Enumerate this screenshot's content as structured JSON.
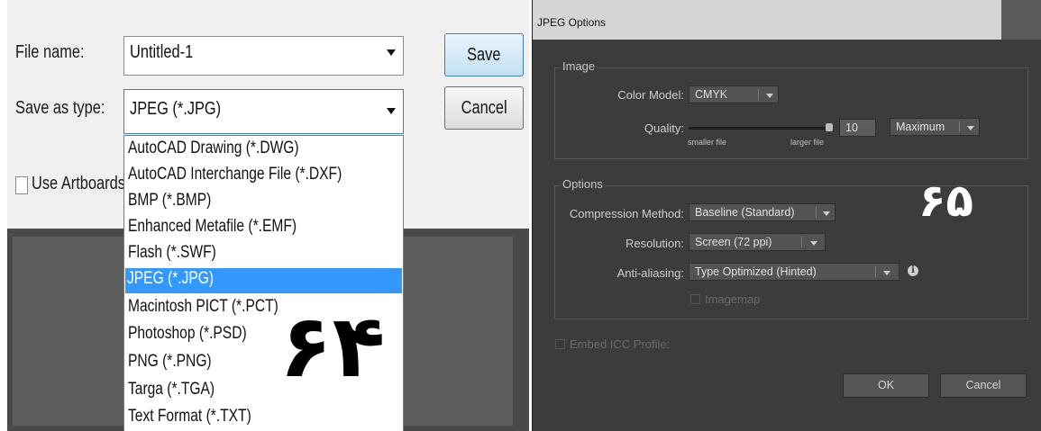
{
  "save_dialog": {
    "file_name_label": "File name:",
    "file_name_value": "Untitled-1",
    "save_as_type_label": "Save as type:",
    "save_as_type_value": "JPEG (*.JPG)",
    "save_button": "Save",
    "cancel_button": "Cancel",
    "use_artboards_label": "Use Artboards",
    "use_artboards_checked": false,
    "type_options": [
      "AutoCAD Drawing (*.DWG)",
      "AutoCAD Interchange File (*.DXF)",
      "BMP (*.BMP)",
      "Enhanced Metafile (*.EMF)",
      "Flash (*.SWF)",
      "JPEG (*.JPG)",
      "Macintosh PICT (*.PCT)",
      "Photoshop (*.PSD)",
      "PNG (*.PNG)",
      "Targa (*.TGA)",
      "Text Format (*.TXT)"
    ],
    "selected_option": "JPEG (*.JPG)",
    "annotation": "۶۴"
  },
  "jpeg_options": {
    "title": "JPEG Options",
    "image_group": {
      "title": "Image",
      "color_model_label": "Color Model:",
      "color_model_value": "CMYK",
      "quality_label": "Quality:",
      "quality_value": "10",
      "quality_level": 1.0,
      "quality_preset": "Maximum",
      "smaller_file": "smaller file",
      "larger_file": "larger file"
    },
    "options_group": {
      "title": "Options",
      "compression_label": "Compression Method:",
      "compression_value": "Baseline (Standard)",
      "resolution_label": "Resolution:",
      "resolution_value": "Screen (72 ppi)",
      "antialias_label": "Anti-aliasing:",
      "antialias_value": "Type Optimized (Hinted)",
      "imagemap_label": "Imagemap",
      "imagemap_checked": false,
      "info_icon": "i"
    },
    "embed_icc_label": "Embed ICC Profile:",
    "embed_icc_checked": false,
    "ok_button": "OK",
    "cancel_button": "Cancel",
    "annotation": "۶۵"
  },
  "colors": {
    "selection": "#3399ff",
    "dialog_dark": "#3c3c3c",
    "dialog_light": "#f0f0f0"
  }
}
